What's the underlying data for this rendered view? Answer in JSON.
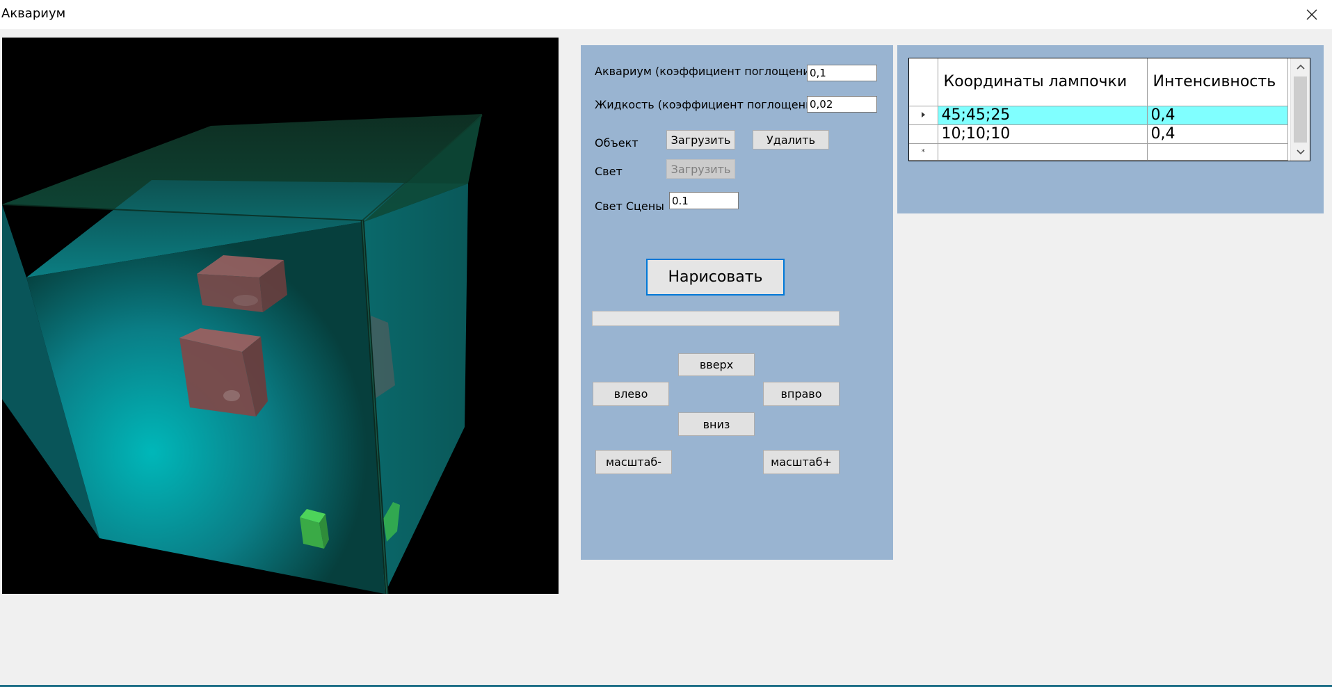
{
  "window": {
    "title": "Аквариум",
    "close_icon": "close-icon"
  },
  "controls": {
    "aquarium_label": "Аквариум (коэффициент поглощения)",
    "aquarium_value": "0,1",
    "liquid_label": "Жидкость (коэффициент поглощения)",
    "liquid_value": "0,02",
    "object_label": "Объект",
    "object_load": "Загрузить",
    "object_delete": "Удалить",
    "light_label": "Свет",
    "light_load": "Загрузить",
    "scene_light_label": "Свет Сцены",
    "scene_light_value": "0.1",
    "draw": "Нарисовать",
    "progress": 0,
    "up": "вверх",
    "left": "влево",
    "right": "вправо",
    "down": "вниз",
    "zoom_out": "масштаб-",
    "zoom_in": "масштаб+"
  },
  "lights_grid": {
    "columns": [
      "Координаты лампочки",
      "Интенсивность"
    ],
    "rows": [
      {
        "coords": "45;45;25",
        "intensity": "0,4",
        "selected": true
      },
      {
        "coords": "10;10;10",
        "intensity": "0,4",
        "selected": false
      }
    ],
    "current_row_icon": "row-pointer-icon",
    "new_row_icon": "new-row-asterisk-icon"
  },
  "colors": {
    "panel": "#99b4d1",
    "selection": "#80ffff",
    "water": "#00a5a8",
    "glass_edge": "#0b3a2a",
    "object_red": "#8a4b4b",
    "object_green": "#3fbf4a"
  }
}
